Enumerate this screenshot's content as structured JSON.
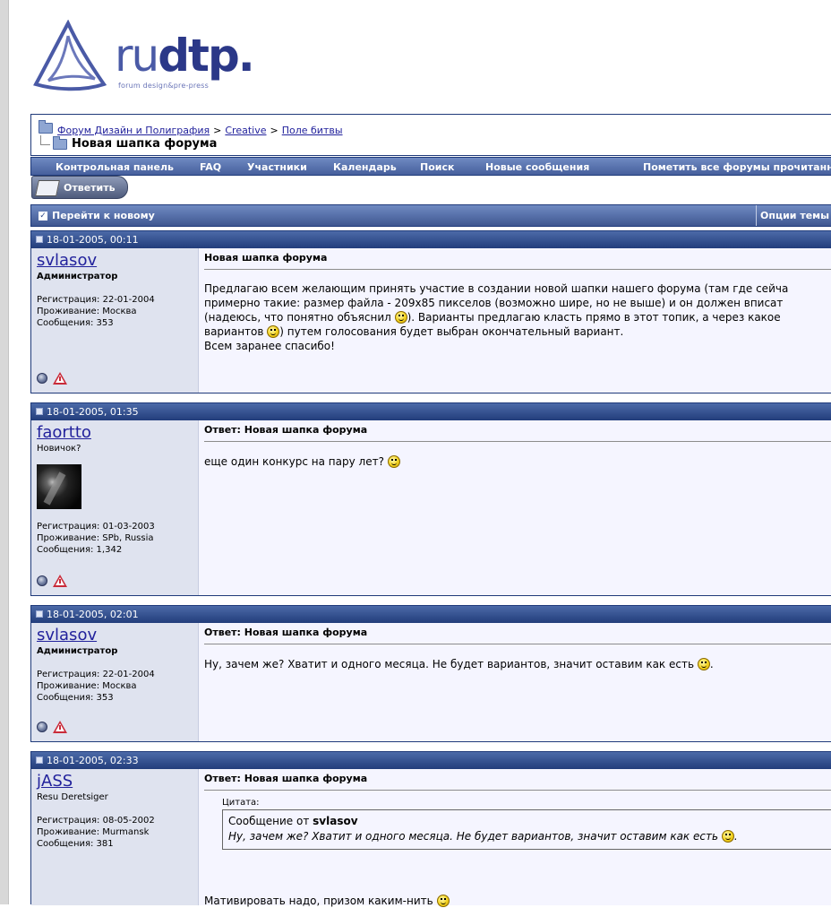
{
  "logo": {
    "word_light": "ru",
    "word_bold": "dtp.",
    "subtitle": "forum design&pre-press"
  },
  "breadcrumb": {
    "forum": "Форум Дизайн и Полиграфия",
    "sep1": ">",
    "section": "Creative",
    "sep2": ">",
    "subsection": "Поле битвы",
    "current": "Новая шапка форума"
  },
  "navbar": {
    "items": [
      "Контрольная панель",
      "FAQ",
      "Участники",
      "Календарь",
      "Поиск",
      "Новые сообщения",
      "Пометить все форумы прочитанными"
    ]
  },
  "reply_button": {
    "label": "Ответить"
  },
  "threadbar": {
    "goto_new": "Перейти к новому",
    "options": "Опции темы"
  },
  "posts": [
    {
      "date": "18-01-2005, 00:11",
      "username": "svlasov",
      "usertitle": "Администратор",
      "reg": "Регистрация: 22-01-2004",
      "location": "Проживание: Москва",
      "messages": "Сообщения: 353",
      "title": "Новая шапка форума",
      "lines": [
        "Предлагаю всем желающим принять участие в создании новой шапки нашего форума (там где сейча",
        "примерно такие: размер файла - 209x85 пикселов (возможно шире, но не выше) и он должен вписат",
        "(надеюсь, что понятно объяснил ",
        "). Варианты предлагаю класть прямо в этот топик, а через какое",
        "вариантов ",
        ") путем голосования будет выбран окончательный вариант.",
        "Всем заранее спасибо!"
      ]
    },
    {
      "date": "18-01-2005, 01:35",
      "username": "faortto",
      "usertitle": "Новичок?",
      "reg": "Регистрация: 01-03-2003",
      "location": "Проживание: SPb, Russia",
      "messages": "Сообщения: 1,342",
      "title": "Ответ: Новая шапка форума",
      "text": "еще один конкурс на пару лет? "
    },
    {
      "date": "18-01-2005, 02:01",
      "username": "svlasov",
      "usertitle": "Администратор",
      "reg": "Регистрация: 22-01-2004",
      "location": "Проживание: Москва",
      "messages": "Сообщения: 353",
      "title": "Ответ: Новая шапка форума",
      "text": "Ну, зачем же? Хватит и одного месяца. Не будет вариантов, значит оставим как есть ",
      "text_end": "."
    },
    {
      "date": "18-01-2005, 02:33",
      "username": "jASS",
      "usertitle": "Resu Deretsiger",
      "reg": "Регистрация: 08-05-2002",
      "location": "Проживание: Murmansk",
      "messages": "Сообщения: 381",
      "title": "Ответ: Новая шапка форума",
      "quote_label": "Цитата:",
      "quote_from": "Сообщение от ",
      "quote_author": "svlasov",
      "quote_text": "Ну, зачем же? Хватит и одного месяца. Не будет вариантов, значит оставим как есть ",
      "quote_end": ".",
      "text": "Мативировать надо, призом каким-нить "
    }
  ]
}
